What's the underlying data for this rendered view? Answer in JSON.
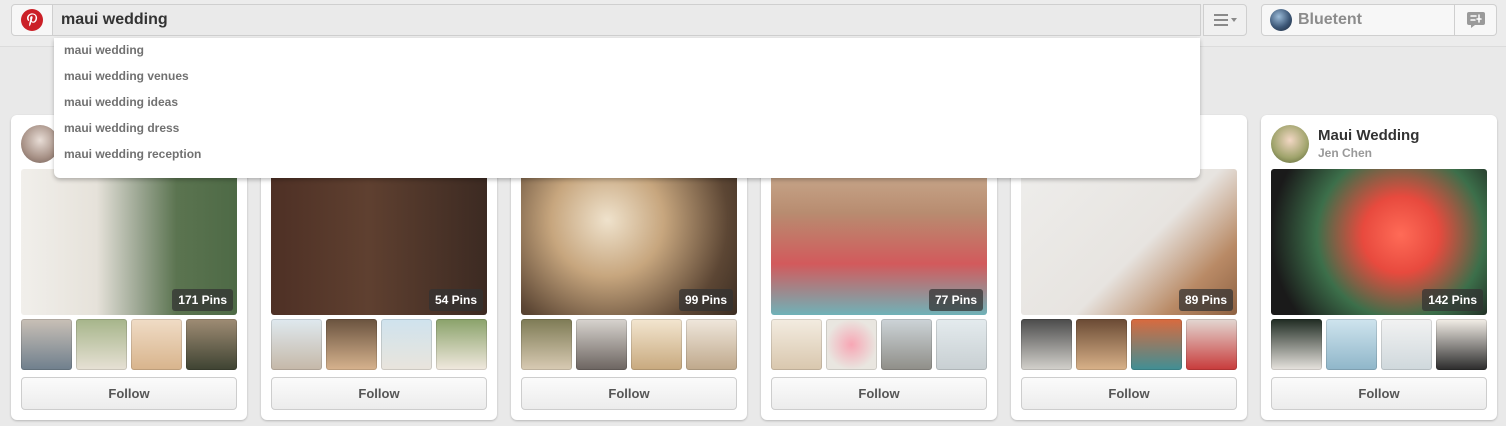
{
  "search": {
    "value": "maui wedding",
    "suggestions": [
      "maui wedding",
      "maui wedding venues",
      "maui wedding ideas",
      "maui wedding dress",
      "maui wedding reception"
    ]
  },
  "user": {
    "name": "Bluetent"
  },
  "icons": {
    "logo": "pinterest-logo-icon",
    "menu": "menu-icon",
    "notifications": "notifications-icon"
  },
  "colors": {
    "brand": "#cb2027"
  },
  "boards": [
    {
      "title": "",
      "owner": "",
      "pins": "171 Pins",
      "follow": "Follow"
    },
    {
      "title": "",
      "owner": "",
      "pins": "54 Pins",
      "follow": "Follow"
    },
    {
      "title": "",
      "owner": "",
      "pins": "99 Pins",
      "follow": "Follow"
    },
    {
      "title": "",
      "owner": "",
      "pins": "77 Pins",
      "follow": "Follow"
    },
    {
      "title": "",
      "owner": "",
      "pins": "89 Pins",
      "follow": "Follow"
    },
    {
      "title": "Maui Wedding",
      "owner": "Jen Chen",
      "pins": "142 Pins",
      "follow": "Follow"
    }
  ]
}
